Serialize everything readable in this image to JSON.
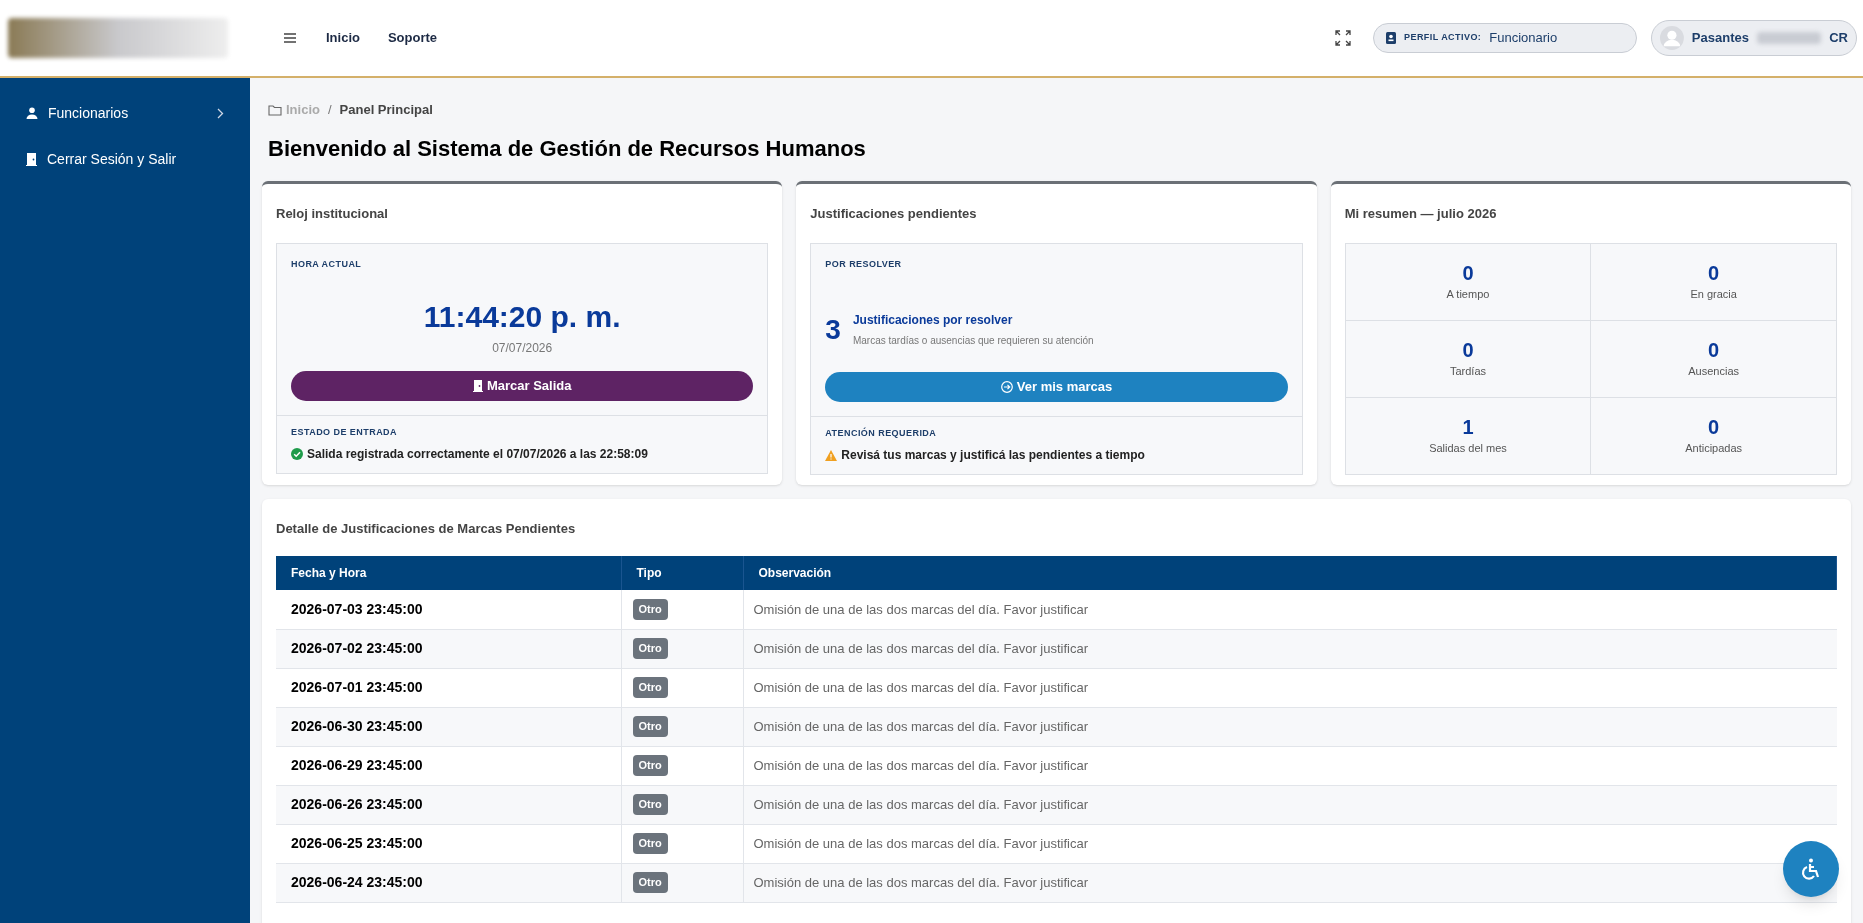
{
  "header": {
    "nav": [
      "Inicio",
      "Soporte"
    ],
    "profile_label": "PERFIL ACTIVO:",
    "profile_value": "Funcionario",
    "user_first": "Pasantes",
    "user_last": "CR"
  },
  "sidebar": {
    "items": [
      {
        "kind": "expandable",
        "label": "Funcionarios"
      },
      {
        "kind": "logout",
        "label": "Cerrar Sesión y Salir"
      }
    ]
  },
  "breadcrumb": [
    "Inicio",
    "Panel Principal"
  ],
  "breadcrumb_separator": "/",
  "title": "Bienvenido al Sistema de Gestión de Recursos Humanos",
  "clock": {
    "title": "Reloj institucional",
    "label": "HORA ACTUAL",
    "time": "11:44:20 p. m.",
    "date": "07/07/2026",
    "button": "Marcar Salida",
    "status_label": "ESTADO DE ENTRADA",
    "status": "Salida registrada correctamente el 07/07/2026 a las 22:58:09"
  },
  "pending": {
    "title": "Justificaciones pendientes",
    "label": "POR RESOLVER",
    "count": "3",
    "heading": "Justificaciones por resolver",
    "note": "Marcas tardías o ausencias que requieren su atención",
    "button": "Ver mis marcas",
    "alert_label": "ATENCIÓN REQUERIDA",
    "alert": "Revisá tus marcas y justificá las pendientes a tiempo"
  },
  "summary": {
    "title": "Mi resumen — julio 2026",
    "stats": [
      {
        "value": "0",
        "label": "A tiempo"
      },
      {
        "value": "0",
        "label": "En gracia"
      },
      {
        "value": "0",
        "label": "Tardías"
      },
      {
        "value": "0",
        "label": "Ausencias"
      },
      {
        "value": "1",
        "label": "Salidas del mes"
      },
      {
        "value": "0",
        "label": "Anticipadas"
      }
    ]
  },
  "table": {
    "title": "Detalle de Justificaciones de Marcas Pendientes",
    "columns": [
      "Fecha y Hora",
      "Tipo",
      "Observación"
    ],
    "rows": [
      {
        "date": "2026-07-03 23:45:00",
        "type": "Otro",
        "note": "Omisión de una de las dos marcas del día. Favor justificar"
      },
      {
        "date": "2026-07-02 23:45:00",
        "type": "Otro",
        "note": "Omisión de una de las dos marcas del día. Favor justificar"
      },
      {
        "date": "2026-07-01 23:45:00",
        "type": "Otro",
        "note": "Omisión de una de las dos marcas del día. Favor justificar"
      },
      {
        "date": "2026-06-30 23:45:00",
        "type": "Otro",
        "note": "Omisión de una de las dos marcas del día. Favor justificar"
      },
      {
        "date": "2026-06-29 23:45:00",
        "type": "Otro",
        "note": "Omisión de una de las dos marcas del día. Favor justificar"
      },
      {
        "date": "2026-06-26 23:45:00",
        "type": "Otro",
        "note": "Omisión de una de las dos marcas del día. Favor justificar"
      },
      {
        "date": "2026-06-25 23:45:00",
        "type": "Otro",
        "note": "Omisión de una de las dos marcas del día. Favor justificar"
      },
      {
        "date": "2026-06-24 23:45:00",
        "type": "Otro",
        "note": "Omisión de una de las dos marcas del día. Favor justificar"
      }
    ]
  }
}
